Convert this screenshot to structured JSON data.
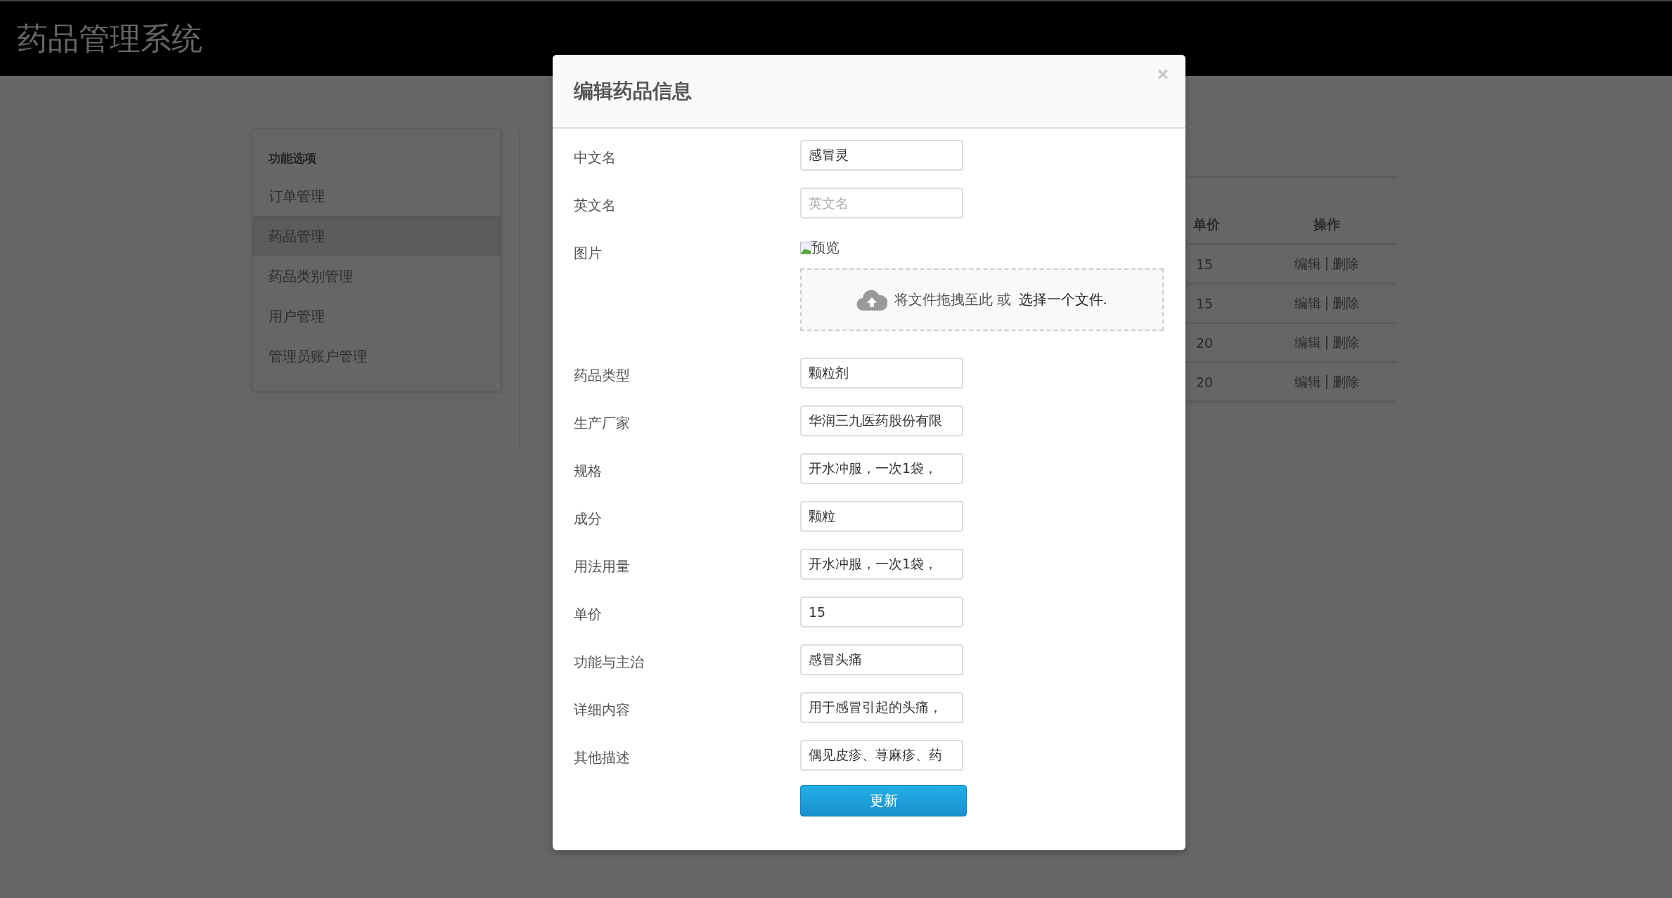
{
  "app_title": "药品管理系统",
  "sidebar": {
    "heading": "功能选项",
    "items": [
      {
        "label": "订单管理",
        "selected": false
      },
      {
        "label": "药品管理",
        "selected": true
      },
      {
        "label": "药品类别管理",
        "selected": false
      },
      {
        "label": "用户管理",
        "selected": false
      },
      {
        "label": "管理员账户管理",
        "selected": false
      }
    ]
  },
  "table": {
    "columns": [
      "单价",
      "操作"
    ],
    "rows": [
      {
        "price": "15",
        "edit": "编辑",
        "separator": "|",
        "delete": "删除"
      },
      {
        "price": "15",
        "edit": "编辑",
        "separator": "|",
        "delete": "删除"
      },
      {
        "price": "20",
        "edit": "编辑",
        "separator": "|",
        "delete": "删除"
      },
      {
        "price": "20",
        "edit": "编辑",
        "separator": "|",
        "delete": "删除"
      }
    ]
  },
  "dialog": {
    "title": "编辑药品信息",
    "close": "×",
    "fields": [
      {
        "kind": "text",
        "label": "中文名",
        "value": "感冒灵"
      },
      {
        "kind": "text",
        "label": "英文名",
        "placeholder": "英文名"
      },
      {
        "kind": "image",
        "label": "图片",
        "preview": "预览",
        "drop_text": "将文件拖拽至此 或",
        "drop_link": "选择一个文件."
      },
      {
        "kind": "text",
        "label": "药品类型",
        "value": "颗粒剂"
      },
      {
        "kind": "text",
        "label": "生产厂家",
        "value": "华润三九医药股份有限"
      },
      {
        "kind": "text",
        "label": "规格",
        "value": "开水冲服，一次1袋，"
      },
      {
        "kind": "text",
        "label": "成分",
        "value": "颗粒"
      },
      {
        "kind": "text",
        "label": "用法用量",
        "value": "开水冲服，一次1袋，"
      },
      {
        "kind": "text",
        "label": "单价",
        "value": "15"
      },
      {
        "kind": "text",
        "label": "功能与主治",
        "value": "感冒头痛"
      },
      {
        "kind": "text",
        "label": "详细内容",
        "value": "用于感冒引起的头痛，"
      },
      {
        "kind": "text",
        "label": "其他描述",
        "value": "偶见皮疹、荨麻疹、药"
      }
    ],
    "submit": "更新"
  }
}
